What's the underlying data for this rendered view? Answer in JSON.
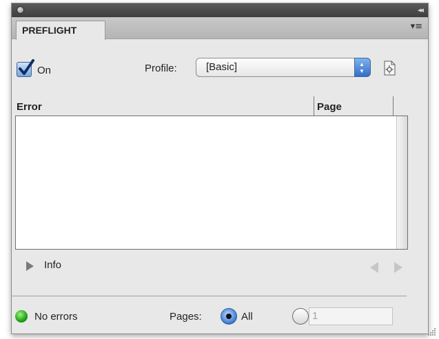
{
  "panel": {
    "tab_label": "PREFLIGHT",
    "collapse_glyph": "◂◂",
    "menu_glyph": "▾≡"
  },
  "controls": {
    "on_label": "On",
    "on_checked": true,
    "profile_label": "Profile:",
    "profile_value": "[Basic]"
  },
  "table": {
    "columns": [
      "Error",
      "Page"
    ],
    "rows": []
  },
  "info": {
    "label": "Info"
  },
  "status": {
    "text": "No errors",
    "indicator_color": "#2fb52a",
    "pages_label": "Pages:",
    "all_label": "All",
    "all_selected": true,
    "page_range_value": "1"
  },
  "colors": {
    "accent": "#3b78d0",
    "panel_bg": "#e8e8e8"
  }
}
